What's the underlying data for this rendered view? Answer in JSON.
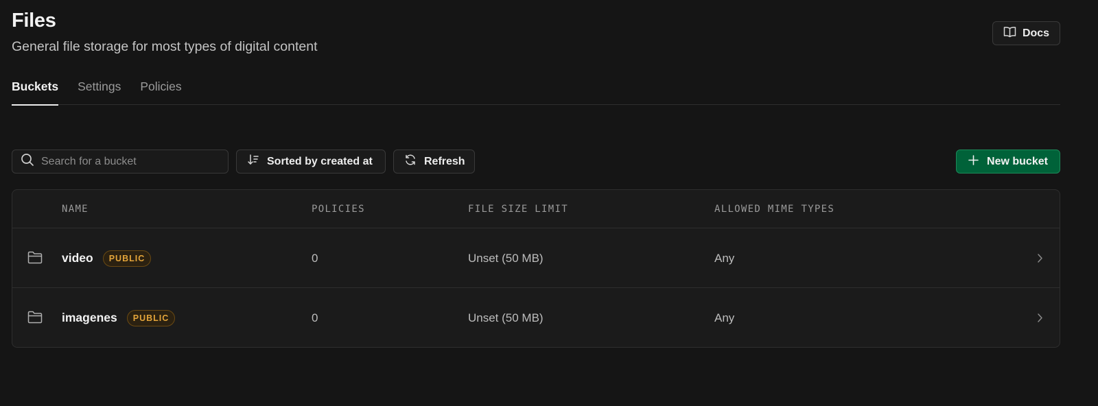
{
  "header": {
    "title": "Files",
    "subtitle": "General file storage for most types of digital content",
    "docs_label": "Docs"
  },
  "tabs": [
    {
      "label": "Buckets",
      "active": true
    },
    {
      "label": "Settings",
      "active": false
    },
    {
      "label": "Policies",
      "active": false
    }
  ],
  "toolbar": {
    "search_placeholder": "Search for a bucket",
    "search_value": "",
    "sort_label": "Sorted by created at",
    "refresh_label": "Refresh",
    "new_bucket_label": "New bucket"
  },
  "table": {
    "columns": [
      "NAME",
      "POLICIES",
      "FILE SIZE LIMIT",
      "ALLOWED MIME TYPES"
    ],
    "rows": [
      {
        "name": "video",
        "badge": "PUBLIC",
        "policies": "0",
        "file_size_limit": "Unset (50 MB)",
        "mime_types": "Any"
      },
      {
        "name": "imagenes",
        "badge": "PUBLIC",
        "policies": "0",
        "file_size_limit": "Unset (50 MB)",
        "mime_types": "Any"
      }
    ]
  },
  "icons": {
    "docs": "book-icon",
    "search": "search-icon",
    "sort": "sort-icon",
    "refresh": "refresh-icon",
    "new": "plus-icon",
    "row": "folder-icon",
    "row_action": "chevron-right-icon"
  },
  "colors": {
    "background": "#151515",
    "primary_button": "#006239",
    "badge_text": "#e3a43a"
  }
}
